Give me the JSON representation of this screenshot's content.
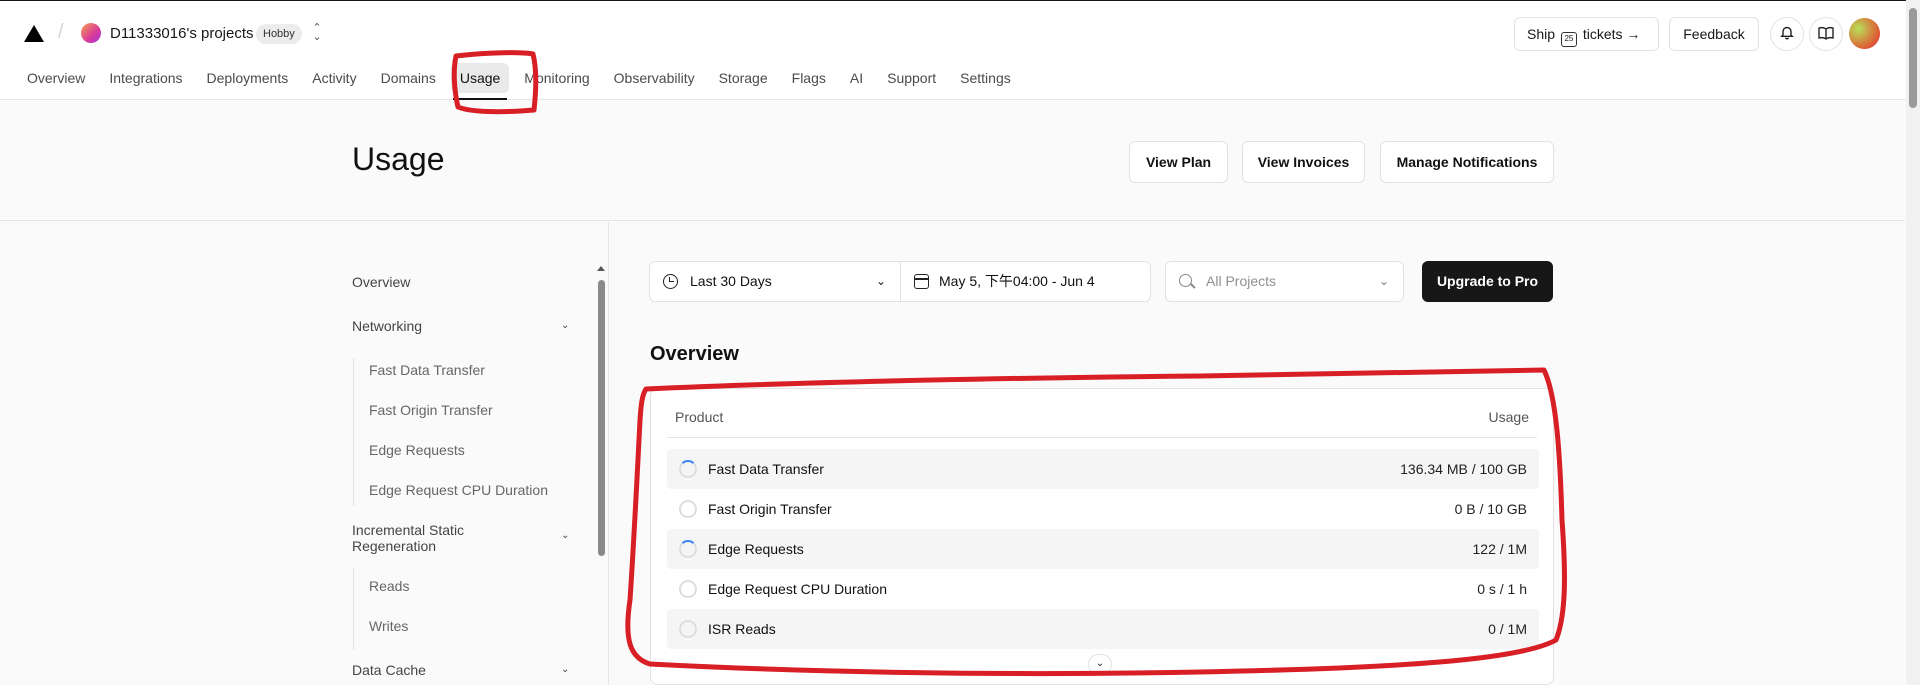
{
  "header": {
    "team_name": "D11333016's projects",
    "plan_badge": "Hobby",
    "ship_prefix": "Ship",
    "ship_calendar_number": "25",
    "ship_suffix": "tickets",
    "ship_arrow": "→",
    "feedback_label": "Feedback",
    "bell_icon": "🔔",
    "docs_icon": "📖"
  },
  "nav": [
    {
      "label": "Overview"
    },
    {
      "label": "Integrations"
    },
    {
      "label": "Deployments"
    },
    {
      "label": "Activity"
    },
    {
      "label": "Domains"
    },
    {
      "label": "Usage",
      "active": true
    },
    {
      "label": "Monitoring"
    },
    {
      "label": "Observability"
    },
    {
      "label": "Storage"
    },
    {
      "label": "Flags"
    },
    {
      "label": "AI"
    },
    {
      "label": "Support"
    },
    {
      "label": "Settings"
    }
  ],
  "page": {
    "title": "Usage",
    "view_plan": "View Plan",
    "view_invoices": "View Invoices",
    "manage_notifications": "Manage Notifications"
  },
  "sidebar": {
    "overview": "Overview",
    "networking": "Networking",
    "networking_items": [
      "Fast Data Transfer",
      "Fast Origin Transfer",
      "Edge Requests",
      "Edge Request CPU Duration"
    ],
    "isr": "Incremental Static Regeneration",
    "isr_items": [
      "Reads",
      "Writes"
    ],
    "data_cache": "Data Cache"
  },
  "filters": {
    "range": "Last 30 Days",
    "date": "May 5, 下午04:00 - Jun 4",
    "projects_placeholder": "All Projects",
    "upgrade": "Upgrade to Pro"
  },
  "overview": {
    "title": "Overview",
    "col_product": "Product",
    "col_usage": "Usage",
    "rows": [
      {
        "name": "Fast Data Transfer",
        "usage": "136.34 MB / 100 GB",
        "fraction": 0.0013
      },
      {
        "name": "Fast Origin Transfer",
        "usage": "0 B / 10 GB",
        "fraction": 0
      },
      {
        "name": "Edge Requests",
        "usage": "122 / 1M",
        "fraction": 0.0001
      },
      {
        "name": "Edge Request CPU Duration",
        "usage": "0 s / 1 h",
        "fraction": 0
      },
      {
        "name": "ISR Reads",
        "usage": "0 / 1M",
        "fraction": 0
      }
    ]
  },
  "colors": {
    "accent": "#171717",
    "annotation": "#d81f26",
    "progress": "#3b82f6"
  }
}
